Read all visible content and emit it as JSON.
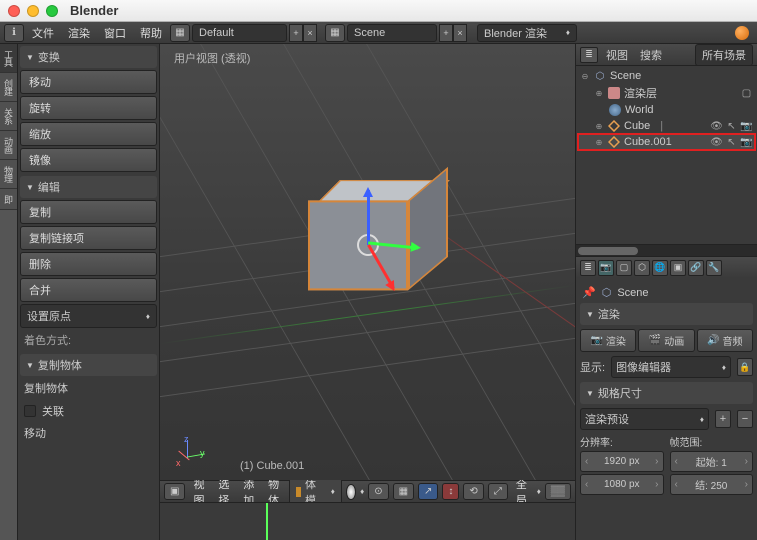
{
  "app": {
    "title": "Blender"
  },
  "topbar": {
    "menus": [
      "文件",
      "渲染",
      "窗口",
      "帮助"
    ],
    "layout": "Default",
    "scene": "Scene",
    "engine": "Blender 渲染"
  },
  "left_tabs": [
    "工具",
    "创建",
    "关系",
    "动画",
    "物理",
    "即"
  ],
  "panels": {
    "transform": {
      "title": "变换",
      "items": [
        "移动",
        "旋转",
        "缩放"
      ],
      "mirror": "镜像"
    },
    "edit": {
      "title": "编辑",
      "items": [
        "复制",
        "复制链接项",
        "删除",
        "合并"
      ],
      "set_origin": "设置原点",
      "color": "着色方式:"
    },
    "dup": {
      "title": "复制物体",
      "label": "复制物体",
      "linked": "关联",
      "move": "移动"
    }
  },
  "viewport": {
    "label": "用户视图 (透视)",
    "object": "(1) Cube.001",
    "header": {
      "menus": [
        "视图",
        "选择",
        "添加",
        "物体"
      ],
      "mode": "物体模式",
      "global": "全局"
    }
  },
  "outliner": {
    "view": "视图",
    "search": "搜索",
    "all_scenes": "所有场景",
    "scene": "Scene",
    "render_layers": "渲染层",
    "world": "World",
    "cube": "Cube",
    "cube001": "Cube.001"
  },
  "props": {
    "crumb_scene": "Scene",
    "render_panel": "渲染",
    "render_btn": "渲染",
    "anim_btn": "动画",
    "audio_btn": "音频",
    "display_label": "显示:",
    "display_value": "图像编辑器",
    "dims_panel": "规格尺寸",
    "preset": "渲染预设",
    "res_label": "分辨率:",
    "res_x": "1920 px",
    "res_y": "1080 px",
    "range_label": "帧范围:",
    "start": "起始: 1",
    "end": "结: 250"
  }
}
